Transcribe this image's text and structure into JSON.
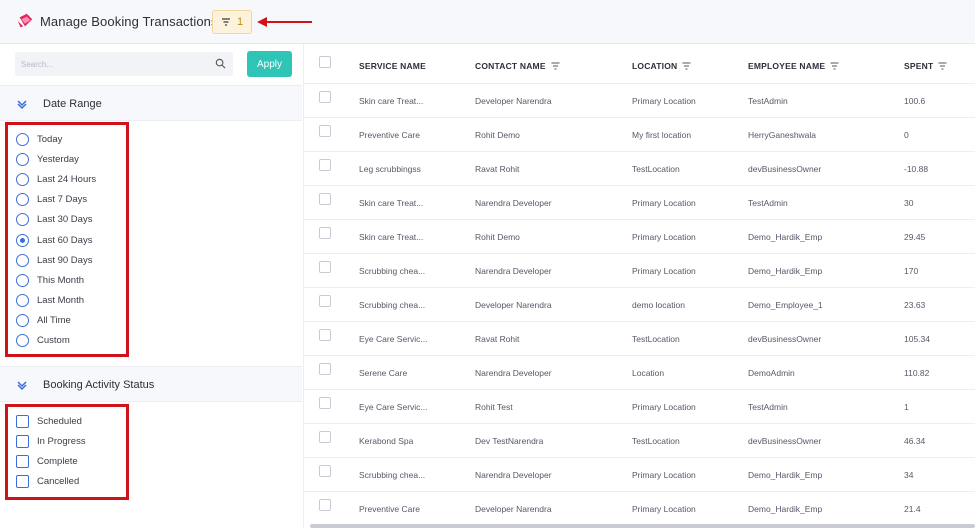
{
  "header": {
    "title": "Manage Booking Transactions",
    "filter_count": "1",
    "brand_color": "#e0245e",
    "arrow_color": "#d0121b"
  },
  "sidebar": {
    "search": {
      "placeholder": "Search..."
    },
    "apply_label": "Apply",
    "date_range": {
      "title": "Date Range",
      "options": [
        {
          "label": "Today",
          "checked": false
        },
        {
          "label": "Yesterday",
          "checked": false
        },
        {
          "label": "Last 24 Hours",
          "checked": false
        },
        {
          "label": "Last 7 Days",
          "checked": false
        },
        {
          "label": "Last 30 Days",
          "checked": false
        },
        {
          "label": "Last 60 Days",
          "checked": true
        },
        {
          "label": "Last 90 Days",
          "checked": false
        },
        {
          "label": "This Month",
          "checked": false
        },
        {
          "label": "Last Month",
          "checked": false
        },
        {
          "label": "All Time",
          "checked": false
        },
        {
          "label": "Custom",
          "checked": false
        }
      ]
    },
    "status": {
      "title": "Booking Activity Status",
      "options": [
        {
          "label": "Scheduled",
          "checked": false
        },
        {
          "label": "In Progress",
          "checked": false
        },
        {
          "label": "Complete",
          "checked": false
        },
        {
          "label": "Cancelled",
          "checked": false
        }
      ]
    }
  },
  "table": {
    "columns": [
      "SERVICE NAME",
      "CONTACT NAME",
      "LOCATION",
      "EMPLOYEE NAME",
      "SPENT"
    ],
    "rows": [
      [
        "Skin care Treat...",
        "Developer Narendra",
        "Primary Location",
        "TestAdmin",
        "100.6"
      ],
      [
        "Preventive Care",
        "Rohit Demo",
        "My first location",
        "HerryGaneshwala",
        "0"
      ],
      [
        "Leg scrubbingss",
        "Ravat Rohit",
        "TestLocation",
        "devBusinessOwner",
        "-10.88"
      ],
      [
        "Skin care Treat...",
        "Narendra Developer",
        "Primary Location",
        "TestAdmin",
        "30"
      ],
      [
        "Skin care Treat...",
        "Rohit Demo",
        "Primary Location",
        "Demo_Hardik_Emp",
        "29.45"
      ],
      [
        "Scrubbing chea...",
        "Narendra Developer",
        "Primary Location",
        "Demo_Hardik_Emp",
        "170"
      ],
      [
        "Scrubbing chea...",
        "Developer Narendra",
        "demo location",
        "Demo_Employee_1",
        "23.63"
      ],
      [
        "Eye Care Servic...",
        "Ravat Rohit",
        "TestLocation",
        "devBusinessOwner",
        "105.34"
      ],
      [
        "Serene Care",
        "Narendra Developer",
        "Location",
        "DemoAdmin",
        "110.82"
      ],
      [
        "Eye Care Servic...",
        "Rohit Test",
        "Primary Location",
        "TestAdmin",
        "1"
      ],
      [
        "Kerabond Spa",
        "Dev TestNarendra",
        "TestLocation",
        "devBusinessOwner",
        "46.34"
      ],
      [
        "Scrubbing chea...",
        "Narendra Developer",
        "Primary Location",
        "Demo_Hardik_Emp",
        "34"
      ],
      [
        "Preventive Care",
        "Developer Narendra",
        "Primary Location",
        "Demo_Hardik_Emp",
        "21.4"
      ]
    ]
  }
}
